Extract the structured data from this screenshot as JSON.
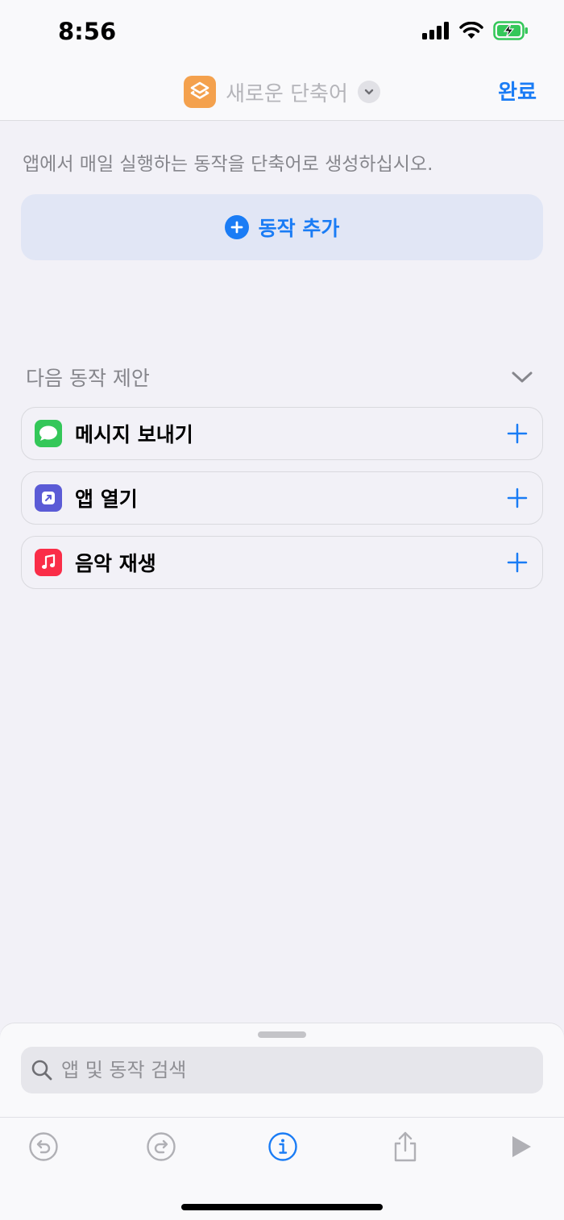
{
  "status_bar": {
    "time": "8:56"
  },
  "nav": {
    "title": "새로운 단축어",
    "done_label": "완료"
  },
  "main": {
    "description": "앱에서 매일 실행하는 동작을 단축어로 생성하십시오.",
    "add_action_label": "동작 추가"
  },
  "suggestions": {
    "title": "다음 동작 제안",
    "items": [
      {
        "label": "메시지 보내기",
        "icon": "messages-icon",
        "color": "#34c759"
      },
      {
        "label": "앱 열기",
        "icon": "open-app-icon",
        "color": "#5b5bd6"
      },
      {
        "label": "음악 재생",
        "icon": "music-icon",
        "color": "#fa2d48"
      }
    ]
  },
  "search": {
    "placeholder": "앱 및 동작 검색"
  },
  "colors": {
    "accent": "#1a7cf5",
    "shortcut_icon": "#f4a14d"
  }
}
